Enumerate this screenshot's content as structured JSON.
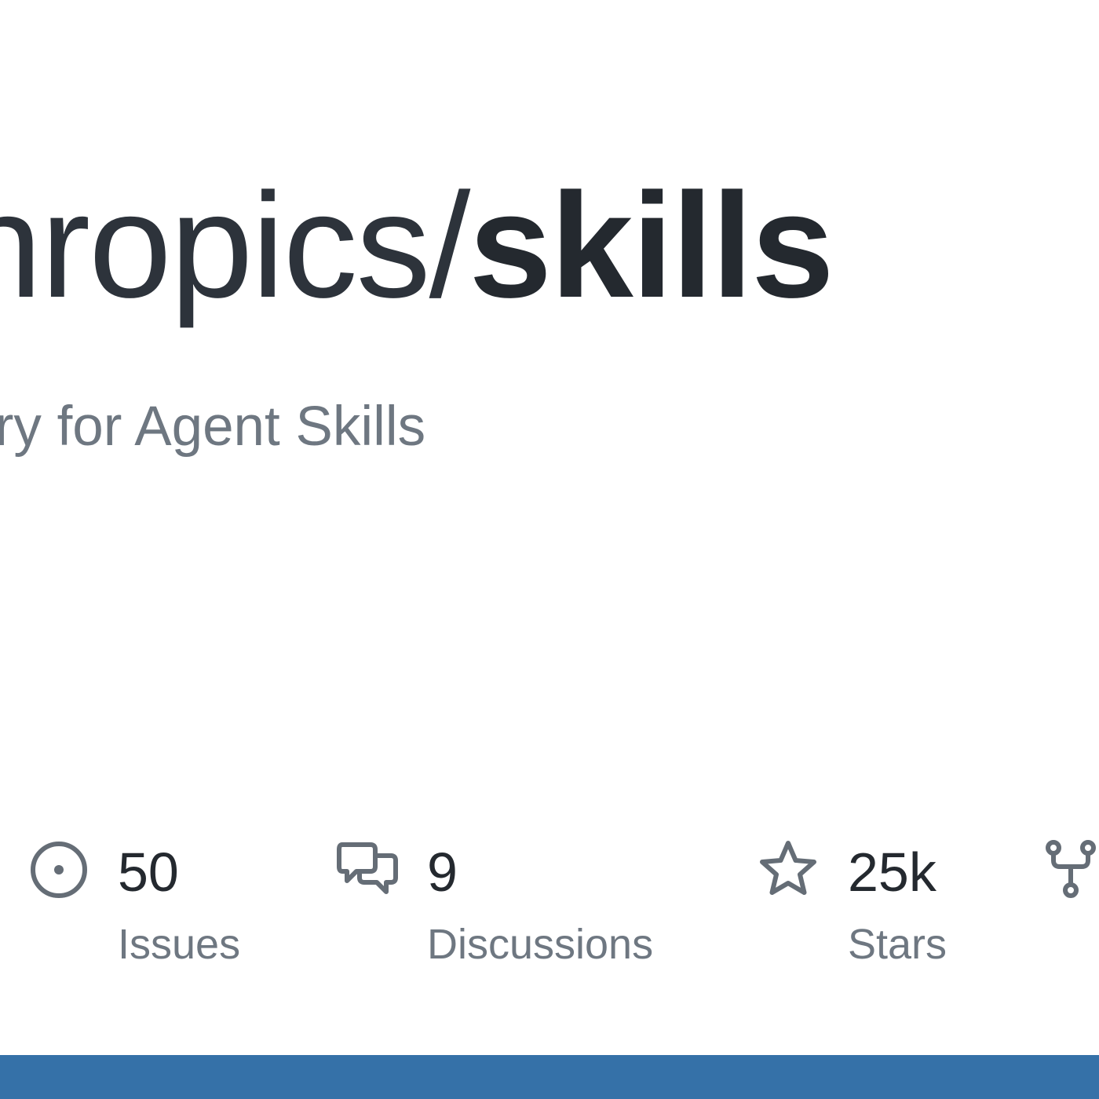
{
  "repo": {
    "owner": "anthropics",
    "separator": "/",
    "name": "skills",
    "description": "Public repository for Agent Skills"
  },
  "stats": [
    {
      "icon": "issue-opened-icon",
      "count": "50",
      "label": "Issues"
    },
    {
      "icon": "discussions-icon",
      "count": "9",
      "label": "Discussions"
    },
    {
      "icon": "star-icon",
      "count": "25k",
      "label": "Stars"
    },
    {
      "icon": "fork-icon",
      "count": "",
      "label": ""
    }
  ],
  "colors": {
    "title": "#24292f",
    "muted": "#6e7781",
    "icon": "#656d76",
    "bottom_bar": "#3571a8",
    "background": "#ffffff"
  }
}
